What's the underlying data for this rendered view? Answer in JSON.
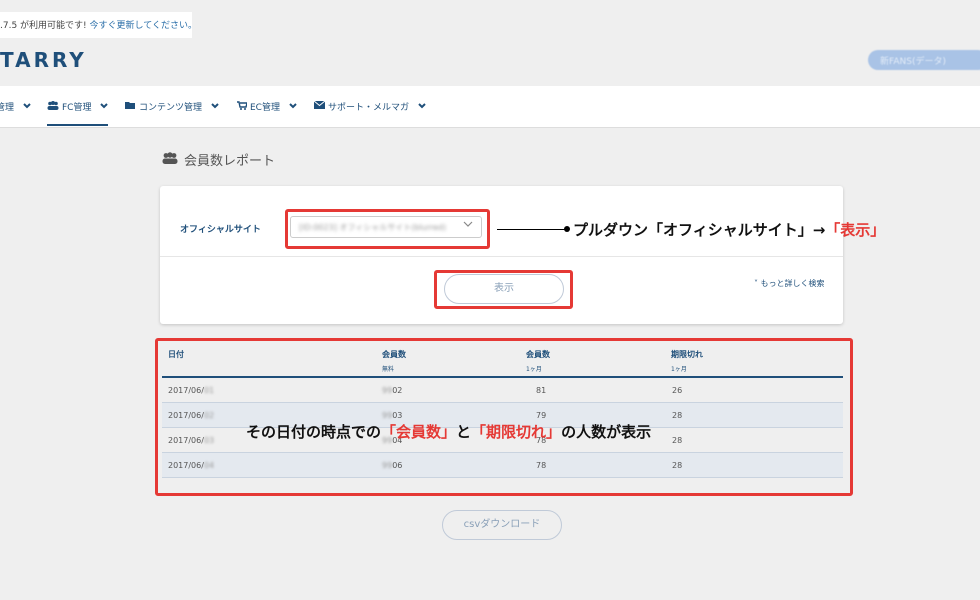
{
  "notice": {
    "text": ".7.5 が利用可能です!",
    "link": "今すぐ更新してください。"
  },
  "header": {
    "logo": "TARRY",
    "user_button": "新FANS(データ)"
  },
  "nav": {
    "items": [
      {
        "label": "管理",
        "icon": "none"
      },
      {
        "label": "FC管理",
        "icon": "users-icon"
      },
      {
        "label": "コンテンツ管理",
        "icon": "folder-icon"
      },
      {
        "label": "EC管理",
        "icon": "cart-icon"
      },
      {
        "label": "サポート・メルマガ",
        "icon": "mail-icon"
      }
    ]
  },
  "page": {
    "title": "会員数レポート",
    "title_icon": "users-icon"
  },
  "filter": {
    "label": "オフィシャルサイト",
    "select_value": "[ID:0023] オフィシャルサイト(blurred)",
    "show_button": "表示",
    "more_link": "もっと詳しく検索"
  },
  "table": {
    "headers": [
      {
        "label": "日付",
        "sub": ""
      },
      {
        "label": "会員数",
        "sub": "無料"
      },
      {
        "label": "会員数",
        "sub": "1ヶ月"
      },
      {
        "label": "期限切れ",
        "sub": "1ヶ月"
      }
    ],
    "rows": [
      {
        "date": "2017/06/",
        "date_hidden": "01",
        "free_hidden": "99",
        "free": "02",
        "paid": "81",
        "expired": "26"
      },
      {
        "date": "2017/06/",
        "date_hidden": "02",
        "free_hidden": "99",
        "free": "03",
        "paid": "79",
        "expired": "28"
      },
      {
        "date": "2017/06/",
        "date_hidden": "03",
        "free_hidden": "99",
        "free": "04",
        "paid": "78",
        "expired": "28"
      },
      {
        "date": "2017/06/",
        "date_hidden": "04",
        "free_hidden": "99",
        "free": "06",
        "paid": "78",
        "expired": "28"
      }
    ]
  },
  "csv_button": "csvダウンロード",
  "annotations": {
    "a1_prefix": "プルダウン「オフィシャルサイト」→",
    "a1_red": "「表示」",
    "a2_part1": "その日付の時点での",
    "a2_red1": "「会員数」",
    "a2_part2": "と",
    "a2_red2": "「期限切れ」",
    "a2_part3": "の人数が表示"
  },
  "colors": {
    "brand": "#1f4f7a",
    "annotation_red": "#e53935"
  }
}
